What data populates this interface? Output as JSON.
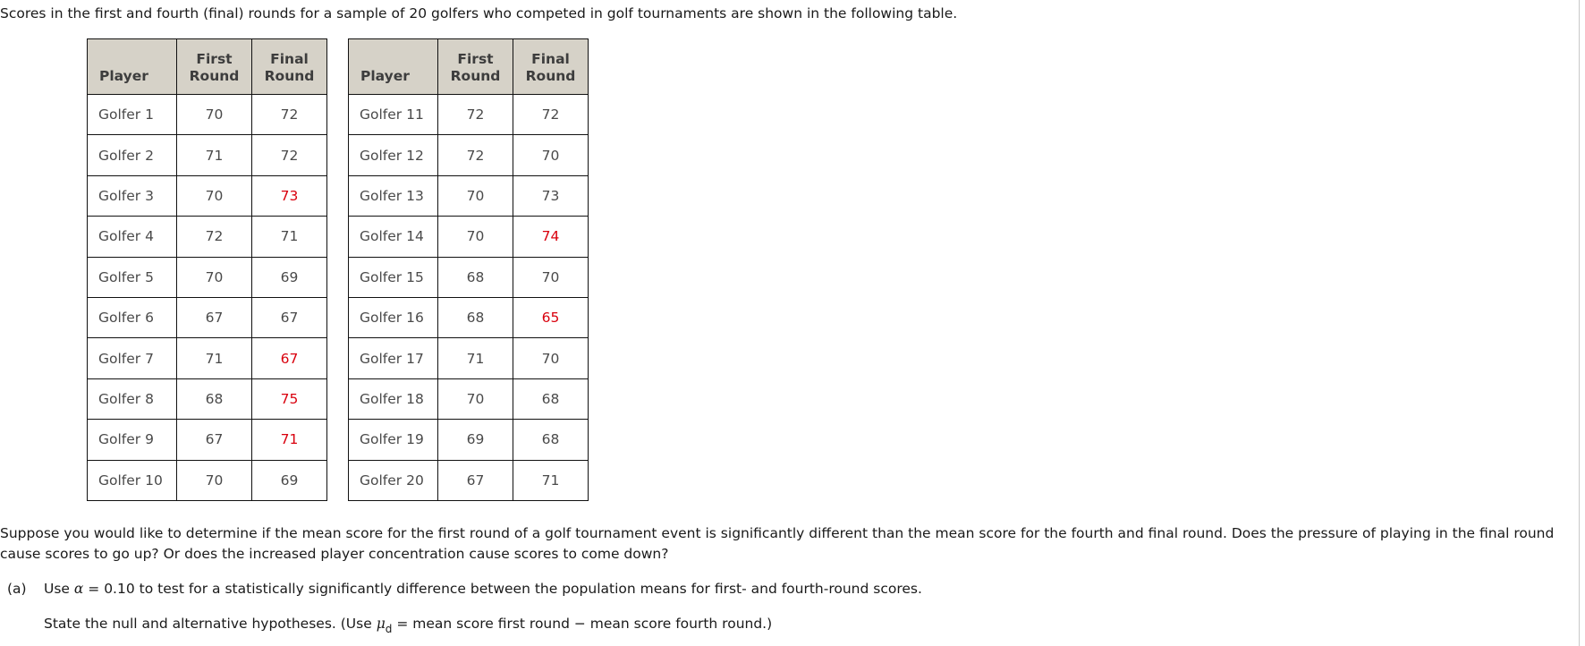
{
  "intro_text": "Scores in the first and fourth (final) rounds for a sample of 20 golfers who competed in golf tournaments are shown in the following table.",
  "table": {
    "headers": {
      "player": "Player",
      "first_line1": "First",
      "first_line2": "Round",
      "final_line1": "Final",
      "final_line2": "Round"
    },
    "highlight_color": "#d9000d",
    "left_rows": [
      {
        "player": "Golfer 1",
        "first": "70",
        "final": "72",
        "final_highlighted": false
      },
      {
        "player": "Golfer 2",
        "first": "71",
        "final": "72",
        "final_highlighted": false
      },
      {
        "player": "Golfer 3",
        "first": "70",
        "final": "73",
        "final_highlighted": true
      },
      {
        "player": "Golfer 4",
        "first": "72",
        "final": "71",
        "final_highlighted": false
      },
      {
        "player": "Golfer 5",
        "first": "70",
        "final": "69",
        "final_highlighted": false
      },
      {
        "player": "Golfer 6",
        "first": "67",
        "final": "67",
        "final_highlighted": false
      },
      {
        "player": "Golfer 7",
        "first": "71",
        "final": "67",
        "final_highlighted": true
      },
      {
        "player": "Golfer 8",
        "first": "68",
        "final": "75",
        "final_highlighted": true
      },
      {
        "player": "Golfer 9",
        "first": "67",
        "final": "71",
        "final_highlighted": true
      },
      {
        "player": "Golfer 10",
        "first": "70",
        "final": "69",
        "final_highlighted": false
      }
    ],
    "right_rows": [
      {
        "player": "Golfer 11",
        "first": "72",
        "final": "72",
        "final_highlighted": false
      },
      {
        "player": "Golfer 12",
        "first": "72",
        "final": "70",
        "final_highlighted": false
      },
      {
        "player": "Golfer 13",
        "first": "70",
        "final": "73",
        "final_highlighted": false
      },
      {
        "player": "Golfer 14",
        "first": "70",
        "final": "74",
        "final_highlighted": true
      },
      {
        "player": "Golfer 15",
        "first": "68",
        "final": "70",
        "final_highlighted": false
      },
      {
        "player": "Golfer 16",
        "first": "68",
        "final": "65",
        "final_highlighted": true
      },
      {
        "player": "Golfer 17",
        "first": "71",
        "final": "70",
        "final_highlighted": false
      },
      {
        "player": "Golfer 18",
        "first": "70",
        "final": "68",
        "final_highlighted": false
      },
      {
        "player": "Golfer 19",
        "first": "69",
        "final": "68",
        "final_highlighted": false
      },
      {
        "player": "Golfer 20",
        "first": "67",
        "final": "71",
        "final_highlighted": false
      }
    ]
  },
  "question_text": "Suppose you would like to determine if the mean score for the first round of a golf tournament event is significantly different than the mean score for the fourth and final round. Does the pressure of playing in the final round cause scores to go up? Or does the increased player concentration cause scores to come down?",
  "part_a": {
    "label": "(a)",
    "prefix": "Use ",
    "alpha_symbol": "α",
    "suffix": " = 0.10 to test for a statistically significantly difference between the population means for first- and fourth-round scores."
  },
  "instruction": {
    "prefix": "State the null and alternative hypotheses. (Use ",
    "mu_symbol": "μ",
    "mu_subscript": "d",
    "suffix": " = mean score first round − mean score fourth round.)"
  }
}
